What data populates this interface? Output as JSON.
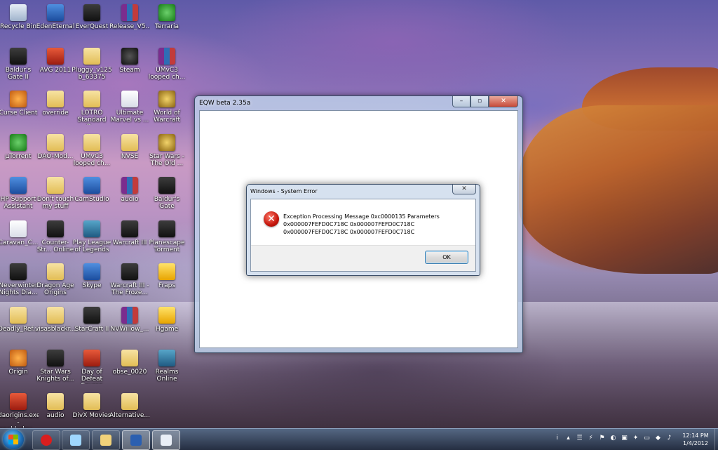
{
  "desktop": {
    "icons": [
      {
        "label": "Recycle Bin",
        "glyph": "recycle-bin-icon"
      },
      {
        "label": "EdenEternal",
        "glyph": "eden-eternal-icon"
      },
      {
        "label": "EverQuest",
        "glyph": "everquest-icon"
      },
      {
        "label": "Release_V5...",
        "glyph": "winrar-archive-icon"
      },
      {
        "label": "Terraria",
        "glyph": "terraria-icon"
      },
      {
        "label": "Baldur's Gate II",
        "glyph": "baldurs-gate-icon"
      },
      {
        "label": "AVG 2011",
        "glyph": "avg-icon"
      },
      {
        "label": "Pluggy_v125 b_63375",
        "glyph": "folder-icon"
      },
      {
        "label": "Steam",
        "glyph": "steam-icon"
      },
      {
        "label": "UMvC3 looped ch...",
        "glyph": "winrar-archive-icon"
      },
      {
        "label": "Curse Client",
        "glyph": "curse-client-icon"
      },
      {
        "label": "override",
        "glyph": "folder-icon"
      },
      {
        "label": "LOTRO Standard R...",
        "glyph": "folder-icon"
      },
      {
        "label": "Ultimate Marvel vs ...",
        "glyph": "mp3-file-icon"
      },
      {
        "label": "World of Warcraft",
        "glyph": "world-of-warcraft-icon"
      },
      {
        "label": "µTorrent",
        "glyph": "utorrent-icon"
      },
      {
        "label": "DAO-Mod...",
        "glyph": "folder-icon"
      },
      {
        "label": "UMvC3 looped ch...",
        "glyph": "folder-icon"
      },
      {
        "label": "NVSE",
        "glyph": "folder-icon"
      },
      {
        "label": "Star Wars - The Old ...",
        "glyph": "star-wars-old-republic-icon"
      },
      {
        "label": "HP Support Assistant",
        "glyph": "hp-support-icon"
      },
      {
        "label": "Don't touch my stuff",
        "glyph": "folder-icon"
      },
      {
        "label": "CamStudio",
        "glyph": "camstudio-icon"
      },
      {
        "label": "audio",
        "glyph": "winrar-archive-icon"
      },
      {
        "label": "Baldur's Gate",
        "glyph": "baldurs-gate-icon"
      },
      {
        "label": "Caravan_C...",
        "glyph": "document-icon"
      },
      {
        "label": "Counter-Str... Online",
        "glyph": "counter-strike-icon"
      },
      {
        "label": "Play League of Legends",
        "glyph": "league-of-legends-icon"
      },
      {
        "label": "Warcraft III",
        "glyph": "warcraft-iii-icon"
      },
      {
        "label": "Planescape Torment",
        "glyph": "planescape-torment-icon"
      },
      {
        "label": "Neverwinter Nights Dia...",
        "glyph": "neverwinter-nights-icon"
      },
      {
        "label": "Dragon Age Origins",
        "glyph": "folder-icon"
      },
      {
        "label": "Skype",
        "glyph": "skype-icon"
      },
      {
        "label": "Warcraft III - The Froze...",
        "glyph": "warcraft-iii-icon"
      },
      {
        "label": "Fraps",
        "glyph": "fraps-icon"
      },
      {
        "label": "Deadly_Ref...",
        "glyph": "folder-icon"
      },
      {
        "label": "visasblackr...",
        "glyph": "folder-icon"
      },
      {
        "label": "StarCraft II",
        "glyph": "starcraft-ii-icon"
      },
      {
        "label": "NVWillow_...",
        "glyph": "winrar-archive-icon"
      },
      {
        "label": "Hgame",
        "glyph": "puzzle-game-icon"
      },
      {
        "label": "Origin",
        "glyph": "origin-icon"
      },
      {
        "label": "Star Wars Knights of...",
        "glyph": "star-wars-knights-icon"
      },
      {
        "label": "Day of Defeat Source",
        "glyph": "day-of-defeat-icon"
      },
      {
        "label": "obse_0020",
        "glyph": "folder-icon"
      },
      {
        "label": "Realms Online",
        "glyph": "realms-online-icon"
      },
      {
        "label": "daorigins.exe -enabledev...",
        "glyph": "dragon-age-icon"
      },
      {
        "label": "audio",
        "glyph": "folder-icon"
      },
      {
        "label": "DivX Movies",
        "glyph": "folder-icon"
      },
      {
        "label": "Alternative...",
        "glyph": "folder-icon"
      }
    ]
  },
  "eqw_window": {
    "title": "EQW beta 2.35a",
    "minimize_glyph": "–",
    "maximize_glyph": "▫",
    "close_glyph": "✕"
  },
  "error_dialog": {
    "title": "Windows - System Error",
    "close_glyph": "✕",
    "icon_glyph": "✕",
    "message": "Exception Processing Message 0xc0000135 Parameters 0x000007FEFD0C718C 0x000007FEFD0C718C 0x000007FEFD0C718C 0x000007FEFD0C718C",
    "ok_label": "OK"
  },
  "taskbar": {
    "pinned": [
      {
        "glyph": "opera-browser-icon"
      },
      {
        "glyph": "windows-media-center-icon"
      },
      {
        "glyph": "file-explorer-icon"
      },
      {
        "glyph": "everquest-taskbar-icon"
      },
      {
        "glyph": "eqw-window-icon"
      }
    ],
    "tray": {
      "info_glyph": "i",
      "chevron_glyph": "▴",
      "icons": [
        "☰",
        "⚡",
        "⚑",
        "◐",
        "▣",
        "✦",
        "▭",
        "◆",
        "♪"
      ]
    },
    "clock": {
      "time": "12:14 PM",
      "date": "1/4/2012"
    }
  },
  "colors": {
    "error_red": "#c4160c",
    "ok_focus_border": "#3c7fb1",
    "close_red": "#c74a38"
  }
}
